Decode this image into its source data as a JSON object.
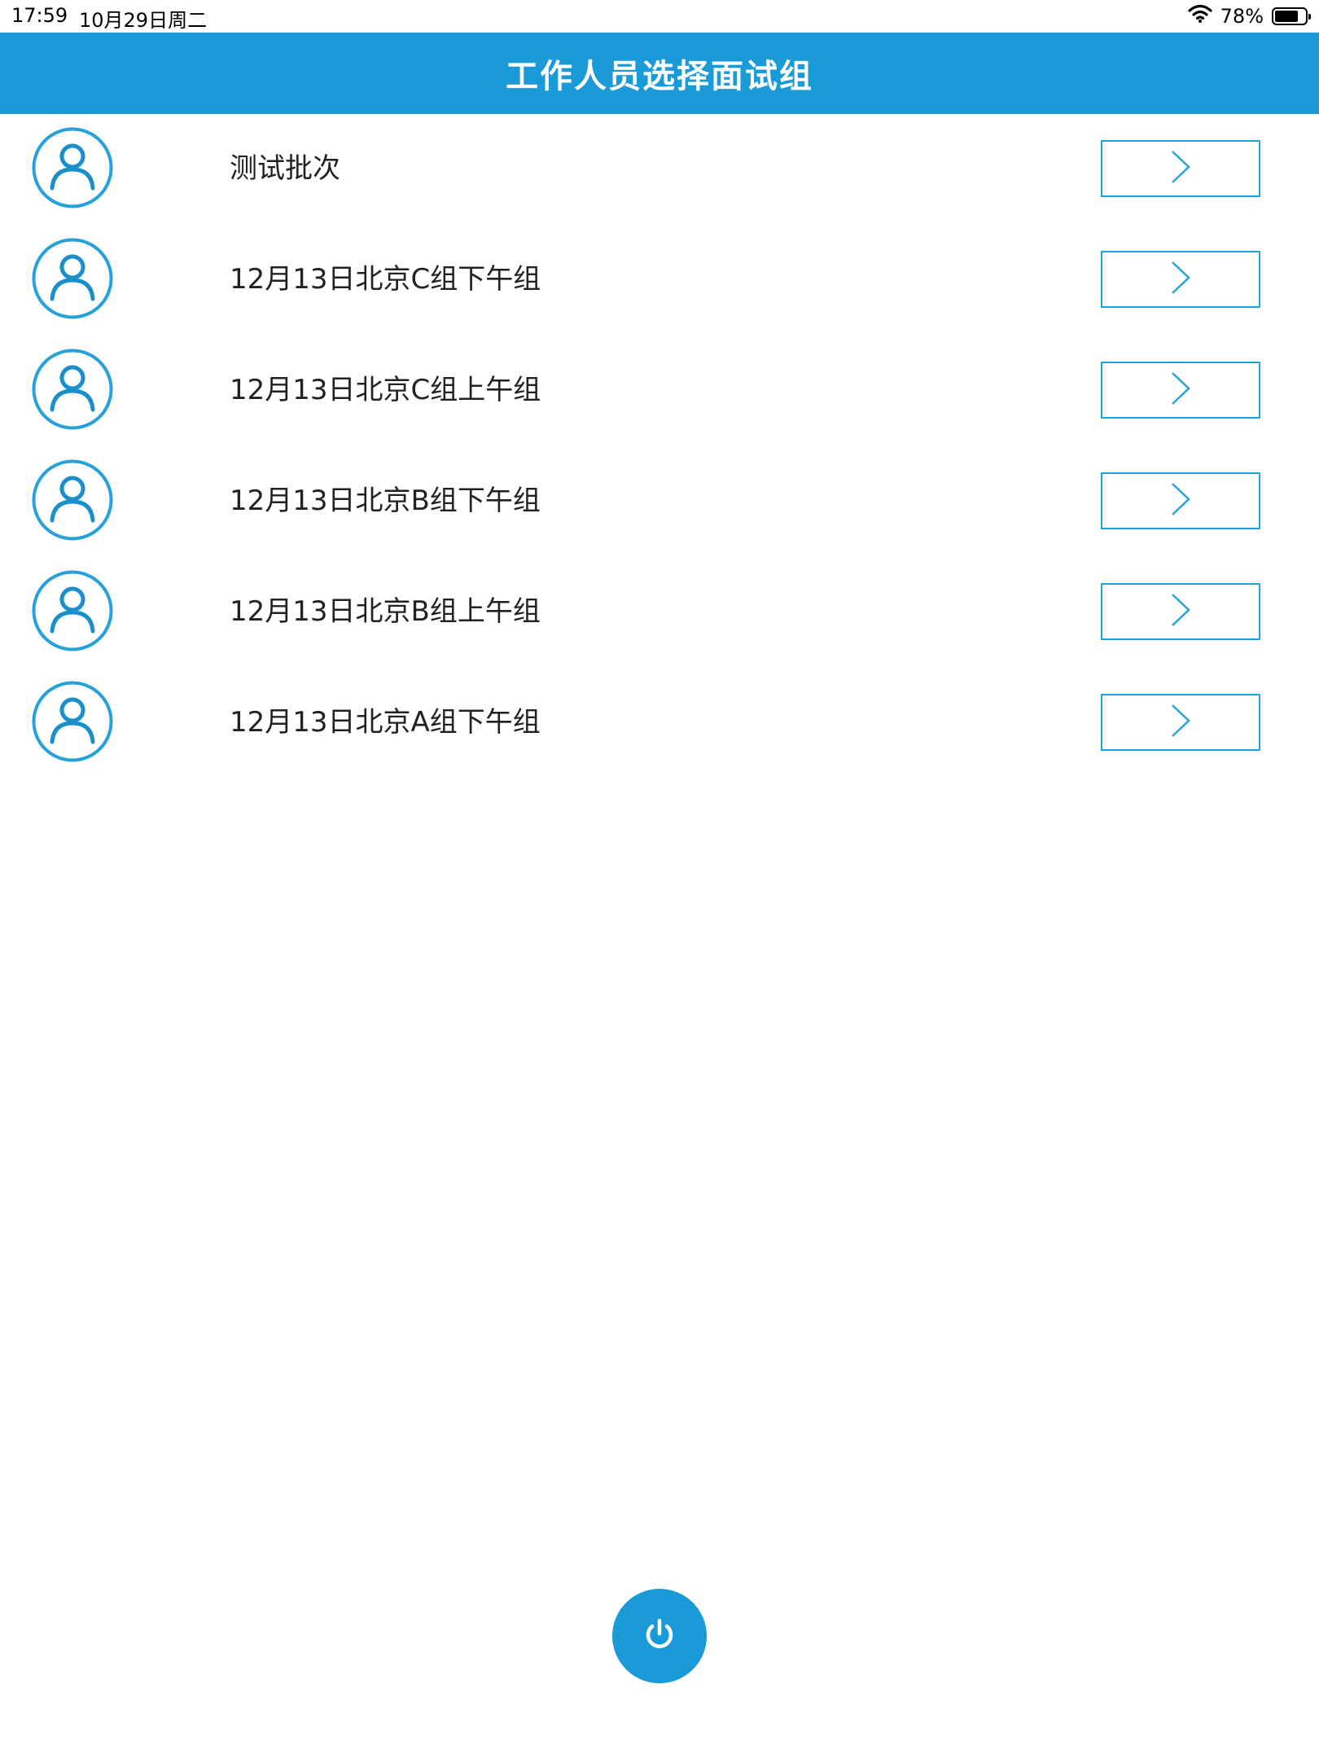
{
  "status_bar": {
    "time": "17:59",
    "date": "10月29日周二",
    "battery": "78%",
    "battery_level": 0.78,
    "wifi_icon": "wifi-icon",
    "battery_icon": "battery-icon"
  },
  "nav": {
    "title": "工作人员选择面试组"
  },
  "groups": [
    {
      "label": "测试批次"
    },
    {
      "label": "12月13日北京C组下午组"
    },
    {
      "label": "12月13日北京C组上午组"
    },
    {
      "label": "12月13日北京B组下午组"
    },
    {
      "label": "12月13日北京B组上午组"
    },
    {
      "label": "12月13日北京A组下午组"
    }
  ],
  "icons": {
    "avatar": "user-avatar-icon",
    "row_action": "chevron-right-icon",
    "power": "power-icon"
  },
  "colors": {
    "accent": "#1a9ad6",
    "button_border": "#27a1da",
    "text": "#222222"
  }
}
